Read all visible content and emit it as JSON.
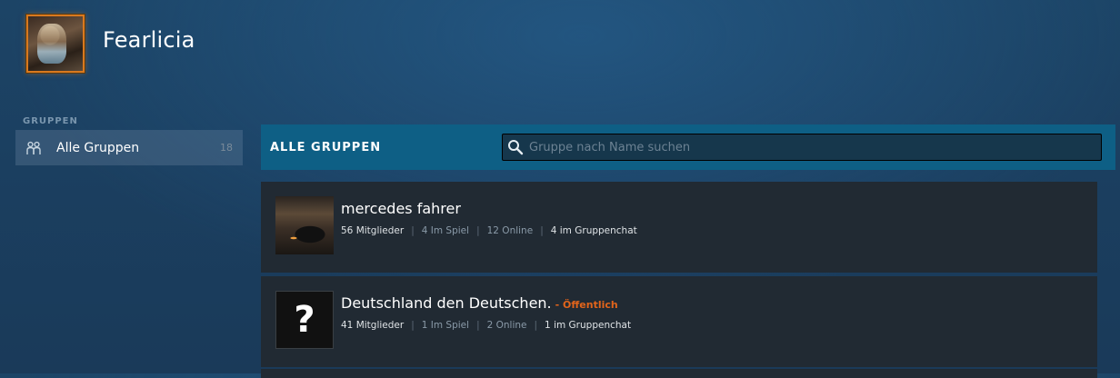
{
  "profile": {
    "username": "Fearlicia"
  },
  "sidebar": {
    "section_title": "GRUPPEN",
    "items": [
      {
        "label": "Alle Gruppen",
        "count": "18",
        "icon": "users-icon"
      }
    ]
  },
  "main": {
    "header_title": "ALLE GRUPPEN",
    "search": {
      "placeholder": "Gruppe nach Name suchen",
      "value": ""
    },
    "groups": [
      {
        "name": "mercedes fahrer",
        "visibility": "",
        "members": "56 Mitglieder",
        "in_game": "4 Im Spiel",
        "online": "12 Online",
        "in_chat": "4 im Gruppenchat",
        "thumb": "car-photo"
      },
      {
        "name": "Deutschland den Deutschen.",
        "visibility": "- Öffentlich",
        "members": "41 Mitglieder",
        "in_game": "1 Im Spiel",
        "online": "2 Online",
        "in_chat": "1 im Gruppenchat",
        "thumb": "?"
      }
    ]
  },
  "colors": {
    "accent": "#0e5f85",
    "public": "#e1641b",
    "avatar_border": "#d9791e"
  }
}
